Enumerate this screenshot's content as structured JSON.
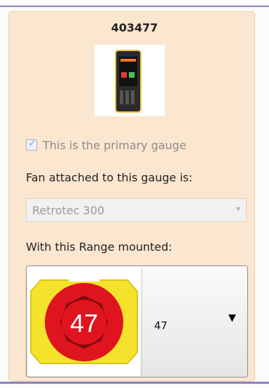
{
  "gauge": {
    "id": "403477",
    "image_icon": "gauge-device-image"
  },
  "primary": {
    "checked": true,
    "label": "This is the primary gauge"
  },
  "fan": {
    "label": "Fan attached to this gauge is:",
    "selected": "Retrotec 300",
    "arrow": "▾"
  },
  "range": {
    "label": "With this Range mounted:",
    "badge": "47",
    "selected": "47",
    "arrow": "▼"
  },
  "colors": {
    "panel": "#fbe6cf",
    "accent_line": "#8a82c4",
    "ring_yellow": "#f4e32a",
    "ring_red": "#e0141e",
    "badge_dark": "#7a0d10"
  }
}
